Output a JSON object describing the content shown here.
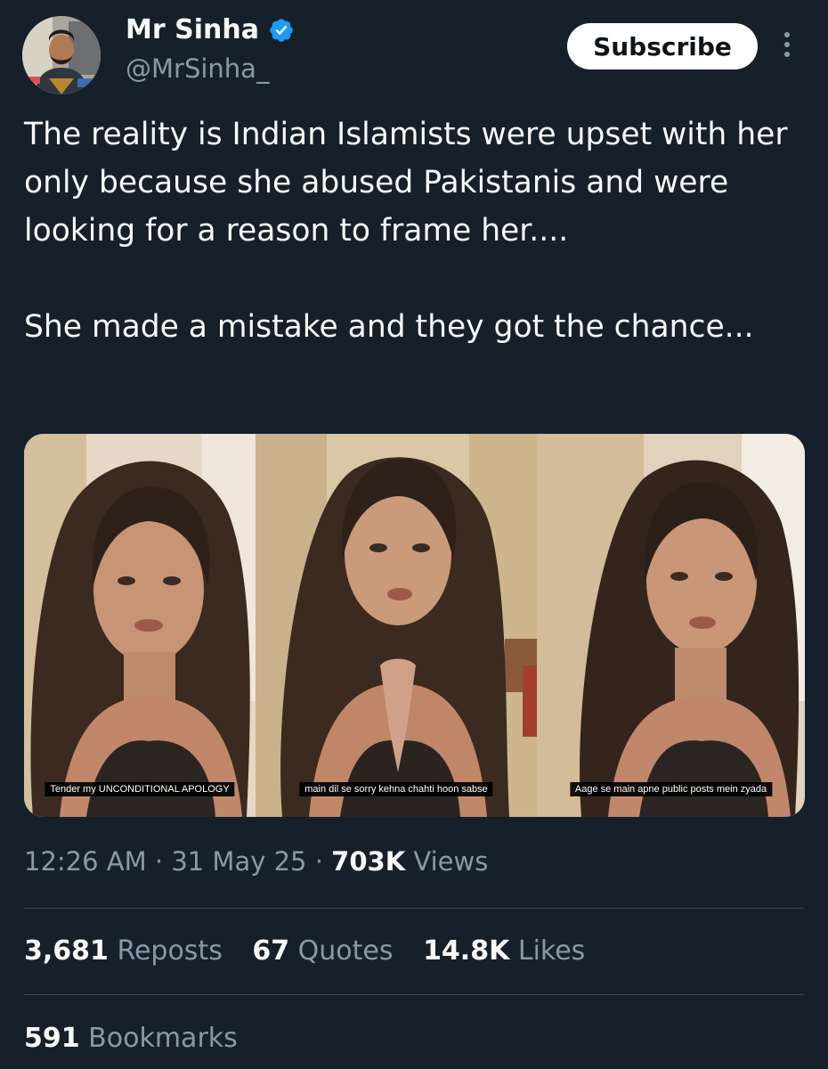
{
  "author": {
    "display_name": "Mr Sinha",
    "handle": "@MrSinha_",
    "verified": true,
    "accent_color": "#1d9bf0"
  },
  "actions": {
    "subscribe_label": "Subscribe",
    "more_icon": "more-vertical-icon"
  },
  "tweet": {
    "paragraphs": [
      "The reality is Indian Islamists were upset with her only because she abused Pakistanis and were looking for a reason to frame her....",
      "She made a mistake and they got the chance..."
    ]
  },
  "media": {
    "frames": [
      {
        "caption": "Tender my UNCONDITIONAL APOLOGY"
      },
      {
        "caption": "main dil se sorry kehna chahti hoon sabse"
      },
      {
        "caption": "Aage se main apne public posts mein zyada"
      }
    ]
  },
  "meta": {
    "time": "12:26 AM",
    "date": "31 May 25",
    "views_count": "703K",
    "views_label": "Views",
    "separator": "·"
  },
  "stats": {
    "reposts_count": "3,681",
    "reposts_label": "Reposts",
    "quotes_count": "67",
    "quotes_label": "Quotes",
    "likes_count": "14.8K",
    "likes_label": "Likes",
    "bookmarks_count": "591",
    "bookmarks_label": "Bookmarks"
  },
  "colors": {
    "background": "#15202b",
    "text_primary": "#f7f9f9",
    "text_secondary": "#8b98a5",
    "divider": "#38444d"
  }
}
